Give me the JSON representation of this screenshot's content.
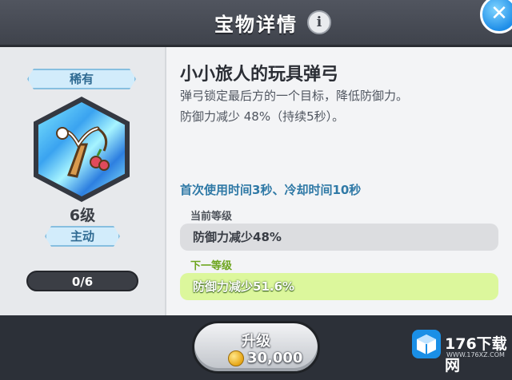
{
  "header": {
    "title": "宝物详情",
    "info_icon": "info-icon",
    "close_icon": "close-icon"
  },
  "item": {
    "rarity": "稀有",
    "level": "6级",
    "type": "主动",
    "progress_text": "0/6",
    "progress_fraction": 0,
    "name": "小小旅人的玩具弹弓",
    "description_line1": "弹弓锁定最后方的一个目标，降低防御力。",
    "description_line2": "防御力减少 48%（持续5秒）。",
    "cooldown": "首次使用时间3秒、冷却时间10秒",
    "current_level_label": "当前等级",
    "current_effect": "防御力减少48%",
    "next_level_label": "下一等级",
    "next_effect": "防御力减少51.6%"
  },
  "upgrade": {
    "label": "升级",
    "cost": "30,000",
    "currency_icon": "gold-coin-icon"
  },
  "watermark": {
    "text": "176下载网",
    "sub": "WWW.176XZ.COM"
  },
  "colors": {
    "rarity_blue": "#2f6a92",
    "next_level_green": "#6da51e",
    "cooldown_blue": "#2f79a6"
  }
}
